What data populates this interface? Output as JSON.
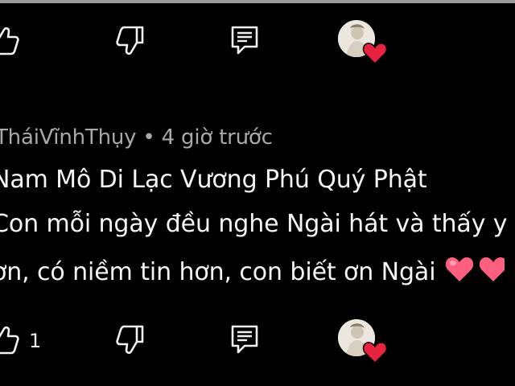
{
  "colors": {
    "background": "#000000",
    "text_primary": "#f4f4f4",
    "text_secondary": "#a9a9a9",
    "heart": "#e8233f",
    "emoji_heart": "#ff5f7e"
  },
  "top_actions": {
    "like_icon": "thumbs-up-icon",
    "dislike_icon": "thumbs-down-icon",
    "reply_icon": "reply-comment-icon",
    "creator_heart_icon": "creator-heart-icon"
  },
  "comment": {
    "author": "@ThaiVinhThuy",
    "author_display": "ThaiVinhThuy",
    "author_visible": "ThaiVinhThuy",
    "meta_author": "ThaiVinhThuy",
    "meta_separator": "•",
    "time": "4 giờ trước",
    "lines": [
      "Nam Mô Di Lạc Vương Phú Quý Phật",
      "Con mỗi ngày đều nghe Ngài hát và thấy y",
      "ơn, có niềm tin hơn, con biết ơn Ngài"
    ],
    "like_count": "1"
  }
}
